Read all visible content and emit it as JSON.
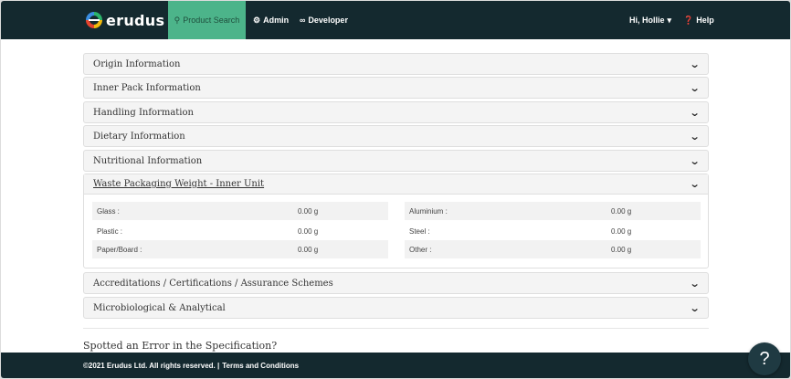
{
  "navbar": {
    "brand": "erudus",
    "product_search": "Product Search",
    "admin": "Admin",
    "developer": "Developer",
    "user_greeting": "Hi, Hollie",
    "help": "Help"
  },
  "panels": [
    {
      "title": "Origin Information"
    },
    {
      "title": "Inner Pack Information"
    },
    {
      "title": "Handling Information"
    },
    {
      "title": "Dietary Information"
    },
    {
      "title": "Nutritional Information"
    }
  ],
  "waste_panel": {
    "title": "Waste Packaging Weight - Inner Unit",
    "left": [
      {
        "label": "Glass :",
        "value": "0.00 g"
      },
      {
        "label": "Plastic :",
        "value": "0.00 g"
      },
      {
        "label": "Paper/Board :",
        "value": "0.00 g"
      }
    ],
    "right": [
      {
        "label": "Aluminium :",
        "value": "0.00 g"
      },
      {
        "label": "Steel :",
        "value": "0.00 g"
      },
      {
        "label": "Other :",
        "value": "0.00 g"
      }
    ]
  },
  "panels_after": [
    {
      "title": "Accreditations / Certifications / Assurance Schemes"
    },
    {
      "title": "Microbiological & Analytical"
    }
  ],
  "error_heading": "Spotted an Error in the Specification?",
  "footer": {
    "copyright": "©2021 Erudus Ltd. All rights reserved. |",
    "terms": "Terms and Conditions"
  },
  "help_bubble": "?",
  "icons": {
    "search": "search-icon",
    "admin": "gear-icon",
    "developer": "glasses-icon",
    "help": "question-circle-icon",
    "chevron": "chevron-down-icon"
  }
}
